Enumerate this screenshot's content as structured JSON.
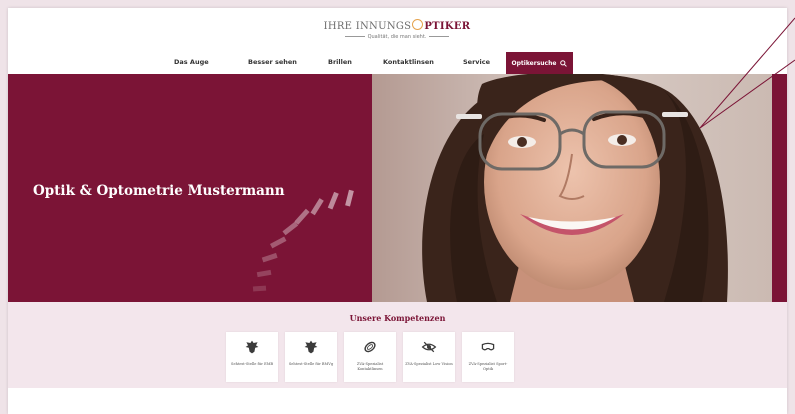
{
  "brand": {
    "logo_part1": "IHRE INNUNGS",
    "logo_part2": "PTIKER",
    "tagline": "Qualität, die man sieht."
  },
  "nav": {
    "items": [
      {
        "label": "Das Auge"
      },
      {
        "label": "Besser sehen"
      },
      {
        "label": "Brillen"
      },
      {
        "label": "Kontaktlinsen"
      },
      {
        "label": "Service"
      }
    ],
    "search_label": "Optikersuche"
  },
  "hero": {
    "title": "Optik & Optometrie Mustermann"
  },
  "competences": {
    "title": "Unsere Kompetenzen",
    "cards": [
      {
        "label": "Sehtest-Stelle für EMB",
        "icon": "eagle-icon"
      },
      {
        "label": "Sehtest-Stelle für BMVg",
        "icon": "eagle-icon"
      },
      {
        "label": "ZVA-Spezialist Kontaktlinsen",
        "icon": "contact-lens-icon"
      },
      {
        "label": "ZVA-Spezialist Low Vision",
        "icon": "eye-slash-icon"
      },
      {
        "label": "ZVA-Spezialist Sport-Optik",
        "icon": "sport-goggles-icon"
      }
    ]
  },
  "colors": {
    "brand": "#7b1436",
    "accent": "#e5a34e",
    "background": "#f3e6ec"
  }
}
